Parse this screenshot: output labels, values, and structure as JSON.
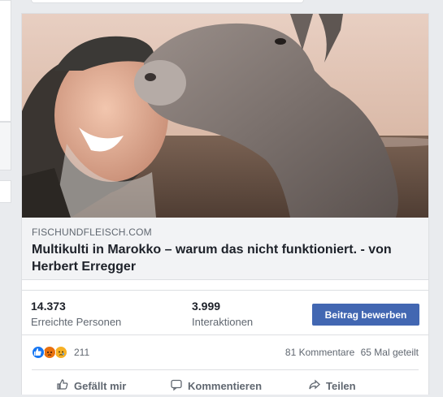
{
  "post": {
    "link": {
      "domain": "FISCHUNDFLEISCH.COM",
      "headline": "Multikulti in Marokko – warum das nicht funktioniert. - von Herbert Erregger"
    },
    "stats": {
      "reach_value": "14.373",
      "reach_label": "Erreichte Personen",
      "engagement_value": "3.999",
      "engagement_label": "Interaktionen",
      "promote_label": "Beitrag bewerben"
    },
    "reactions": {
      "icons": [
        "like-icon",
        "angry-icon",
        "sad-icon"
      ],
      "count": "211",
      "comments": "81 Kommentare",
      "shares": "65 Mal geteilt"
    },
    "actions": [
      {
        "label": "Gefällt mir",
        "icon": "thumbs-up-icon"
      },
      {
        "label": "Kommentieren",
        "icon": "comment-icon"
      },
      {
        "label": "Teilen",
        "icon": "share-icon"
      }
    ]
  },
  "colors": {
    "accent": "#4267b2",
    "like": "#1877f2",
    "angry": "#e9710f",
    "sad": "#f7b125"
  }
}
